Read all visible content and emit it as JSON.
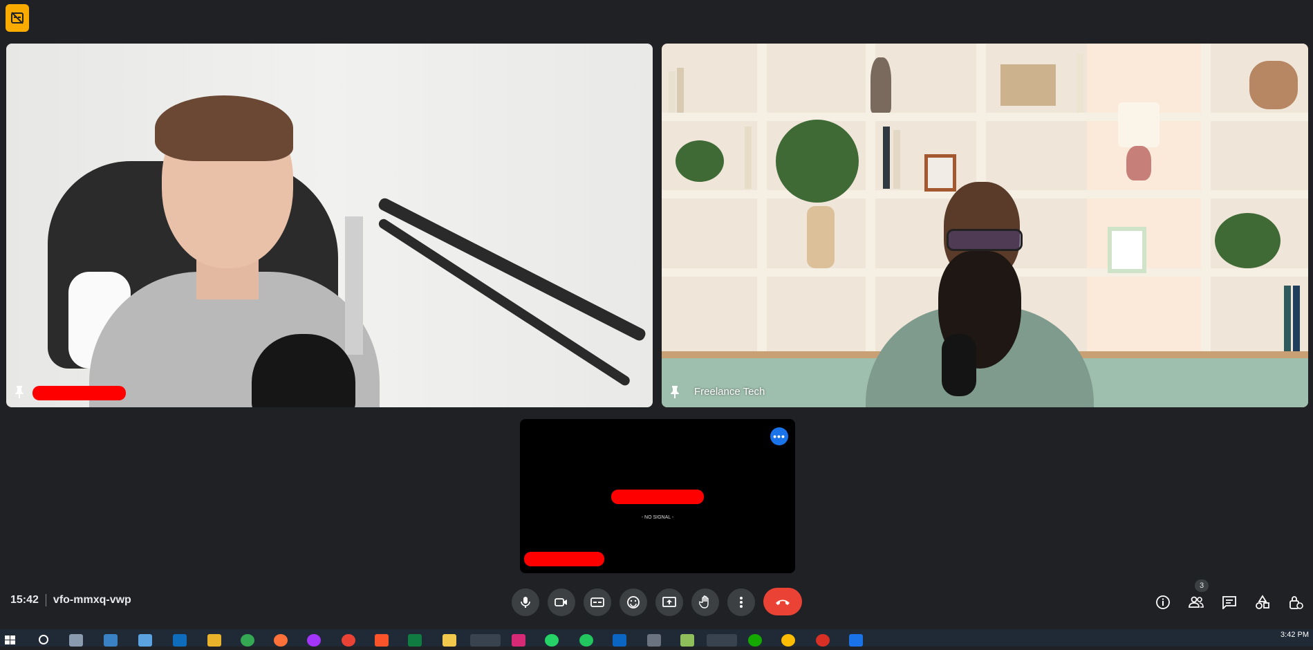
{
  "meeting": {
    "time": "15:42",
    "code": "vfo-mmxq-vwp"
  },
  "participants": [
    {
      "name": ""
    },
    {
      "name": "Freelance Tech"
    },
    {
      "name": "",
      "status": "- NO SIGNAL -"
    }
  ],
  "controls": [
    {
      "icon": "mic-icon"
    },
    {
      "icon": "camera-icon"
    },
    {
      "icon": "captions-icon"
    },
    {
      "icon": "emoji-icon"
    },
    {
      "icon": "present-icon"
    },
    {
      "icon": "raise-hand-icon"
    },
    {
      "icon": "more-options-icon"
    },
    {
      "icon": "end-call-icon"
    }
  ],
  "right_controls": {
    "people_count": "3",
    "icons": [
      "info-icon",
      "people-icon",
      "chat-icon",
      "activities-icon",
      "host-controls-icon"
    ]
  },
  "taskbar": {
    "clock": "3:42 PM"
  },
  "colors": {
    "background": "#202124",
    "end_call": "#ea4335",
    "accent": "#1a73e8",
    "badge": "#f9ab00"
  }
}
